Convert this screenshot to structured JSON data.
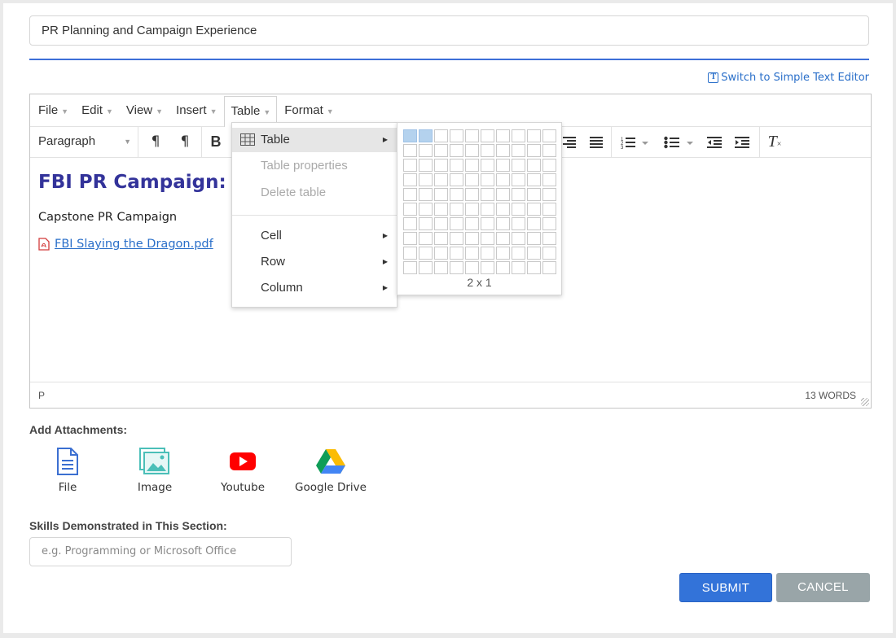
{
  "title_field": {
    "value": "PR Planning and Campaign Experience"
  },
  "switch_editor": {
    "label": "Switch to Simple Text Editor",
    "icon": "text-editor-icon"
  },
  "menubar": {
    "items": [
      {
        "label": "File"
      },
      {
        "label": "Edit"
      },
      {
        "label": "View"
      },
      {
        "label": "Insert"
      },
      {
        "label": "Table"
      },
      {
        "label": "Format"
      }
    ],
    "active": "Table"
  },
  "toolbar": {
    "block_format": "Paragraph"
  },
  "content": {
    "heading": "FBI PR Campaign:",
    "paragraph": "Capstone PR Campaign",
    "attachment_link": "FBI Slaying the Dragon.pdf"
  },
  "statusbar": {
    "path": "P",
    "word_count": "13 WORDS"
  },
  "table_menu": {
    "items": [
      {
        "label": "Table",
        "submenu": true,
        "disabled": false,
        "hover": true
      },
      {
        "label": "Table properties",
        "submenu": false,
        "disabled": true
      },
      {
        "label": "Delete table",
        "submenu": false,
        "disabled": true
      },
      {
        "label": "Cell",
        "submenu": true,
        "disabled": false
      },
      {
        "label": "Row",
        "submenu": true,
        "disabled": false
      },
      {
        "label": "Column",
        "submenu": true,
        "disabled": false
      }
    ]
  },
  "table_grid": {
    "cols": 10,
    "rows": 10,
    "selected_cols": 2,
    "selected_rows": 1,
    "label": "2 x 1"
  },
  "attachments": {
    "label": "Add Attachments:",
    "items": [
      {
        "label": "File",
        "icon": "file-icon"
      },
      {
        "label": "Image",
        "icon": "image-icon"
      },
      {
        "label": "Youtube",
        "icon": "youtube-icon"
      },
      {
        "label": "Google Drive",
        "icon": "google-drive-icon"
      }
    ]
  },
  "skills": {
    "label": "Skills Demonstrated in This Section:",
    "placeholder": "e.g. Programming or Microsoft Office"
  },
  "buttons": {
    "submit": "SUBMIT",
    "cancel": "CANCEL"
  },
  "colors": {
    "accent": "#3373d9",
    "heading": "#33339a",
    "link": "#2a6fc9",
    "cancel": "#99a5a8"
  }
}
